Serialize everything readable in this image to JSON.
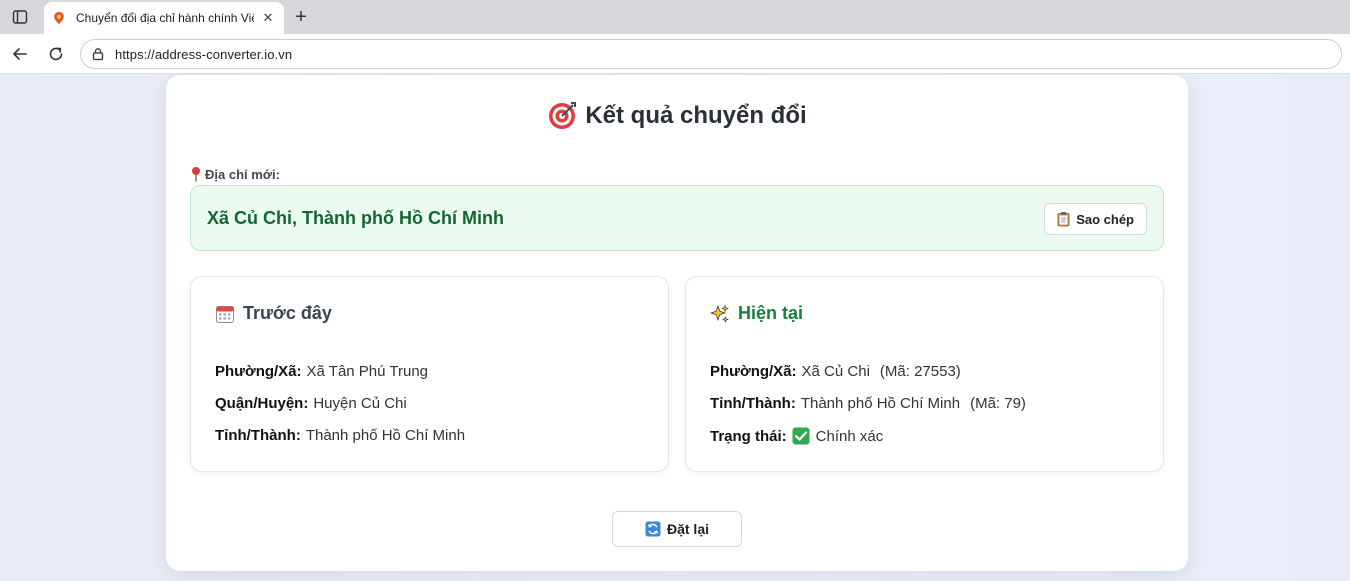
{
  "browser": {
    "tab_title": "Chuyển đổi địa chỉ hành chính Việt Nam",
    "url": "https://address-converter.io.vn"
  },
  "result": {
    "heading": "Kết quả chuyển đổi",
    "new_address_label": "Địa chỉ mới:",
    "new_address": "Xã Củ Chi, Thành phố Hồ Chí Minh",
    "copy_label": "Sao chép"
  },
  "before": {
    "title": "Trước đây",
    "rows": [
      {
        "key": "Phường/Xã:",
        "value": "Xã Tân Phú Trung"
      },
      {
        "key": "Quận/Huyện:",
        "value": "Huyện Củ Chi"
      },
      {
        "key": "Tỉnh/Thành:",
        "value": "Thành phố Hồ Chí Minh"
      }
    ]
  },
  "current": {
    "title": "Hiện tại",
    "ward": {
      "key": "Phường/Xã:",
      "value": "Xã Củ Chi",
      "code": "(Mã: 27553)"
    },
    "province": {
      "key": "Tỉnh/Thành:",
      "value": "Thành phố Hồ Chí Minh",
      "code": "(Mã: 79)"
    },
    "status": {
      "key": "Trạng thái:",
      "value": "Chính xác",
      "icon": "check-icon"
    }
  },
  "reset_label": "Đặt lại",
  "colors": {
    "accent_green": "#15803d",
    "result_bg": "#ecfbf0",
    "result_border": "#bfe9cc",
    "address_text": "#166534"
  }
}
